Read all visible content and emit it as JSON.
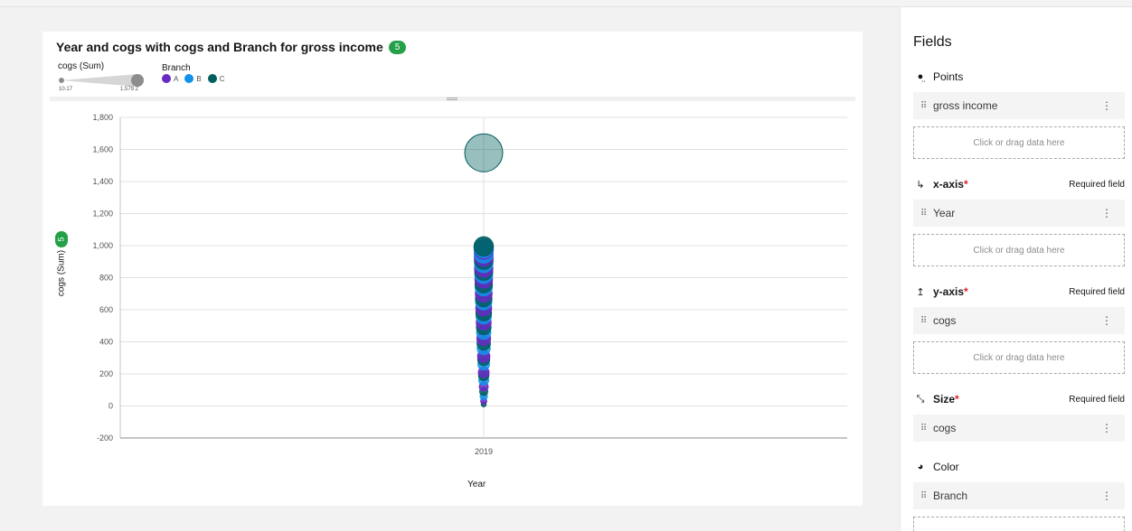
{
  "chart_card": {
    "title": "Year and cogs with cogs and Branch for gross income",
    "count_badge": "5",
    "size_legend": {
      "label": "cogs (Sum)",
      "min": "10.17",
      "max": "1,579.2"
    },
    "color_legend": {
      "label": "Branch",
      "items": [
        {
          "label": "A",
          "color": "#6929c4"
        },
        {
          "label": "B",
          "color": "#1192e8"
        },
        {
          "label": "C",
          "color": "#005d5d"
        }
      ]
    },
    "yaxis_badge": "5"
  },
  "chart_data": {
    "type": "scatter",
    "title": "Year and cogs with cogs and Branch for gross income",
    "xlabel": "Year",
    "ylabel": "cogs (Sum)",
    "categories": [
      "2019"
    ],
    "ylim": [
      -200,
      1800
    ],
    "yticks": [
      "-200",
      "0",
      "200",
      "400",
      "600",
      "800",
      "1,000",
      "1,200",
      "1,400",
      "1,600",
      "1,800"
    ],
    "grid": true,
    "size_field": "cogs (Sum)",
    "color_field": "Branch",
    "series": [
      {
        "name": "A",
        "color": "#6929c4",
        "points": [
          [
            2019,
            30
          ],
          [
            2019,
            120
          ],
          [
            2019,
            210
          ],
          [
            2019,
            310
          ],
          [
            2019,
            420
          ],
          [
            2019,
            520
          ],
          [
            2019,
            610
          ],
          [
            2019,
            700
          ],
          [
            2019,
            790
          ],
          [
            2019,
            860
          ],
          [
            2019,
            930
          ],
          [
            2019,
            975
          ]
        ]
      },
      {
        "name": "B",
        "color": "#1192e8",
        "points": [
          [
            2019,
            60
          ],
          [
            2019,
            160
          ],
          [
            2019,
            260
          ],
          [
            2019,
            360
          ],
          [
            2019,
            460
          ],
          [
            2019,
            560
          ],
          [
            2019,
            650
          ],
          [
            2019,
            740
          ],
          [
            2019,
            820
          ],
          [
            2019,
            890
          ],
          [
            2019,
            950
          ],
          [
            2019,
            985
          ]
        ]
      },
      {
        "name": "C",
        "color": "#005d5d",
        "points": [
          [
            2019,
            10
          ],
          [
            2019,
            90
          ],
          [
            2019,
            190
          ],
          [
            2019,
            290
          ],
          [
            2019,
            390
          ],
          [
            2019,
            490
          ],
          [
            2019,
            580
          ],
          [
            2019,
            670
          ],
          [
            2019,
            760
          ],
          [
            2019,
            840
          ],
          [
            2019,
            910
          ],
          [
            2019,
            995
          ],
          [
            2019,
            1579.2
          ]
        ]
      }
    ]
  },
  "fields_panel": {
    "title": "Fields",
    "sections": [
      {
        "id": "points",
        "icon": "points-icon",
        "label": "Points",
        "required": false,
        "value": "gross income",
        "drop_text": "Click or drag data here"
      },
      {
        "id": "xaxis",
        "icon": "x-axis-icon",
        "label": "x-axis",
        "required": true,
        "required_text": "Required field",
        "value": "Year",
        "drop_text": "Click or drag data here"
      },
      {
        "id": "yaxis",
        "icon": "y-axis-icon",
        "label": "y-axis",
        "required": true,
        "required_text": "Required field",
        "value": "cogs",
        "drop_text": "Click or drag data here"
      },
      {
        "id": "size",
        "icon": "size-icon",
        "label": "Size",
        "required": true,
        "required_text": "Required field",
        "value": "cogs"
      },
      {
        "id": "color",
        "icon": "palette-icon",
        "label": "Color",
        "required": false,
        "value": "Branch"
      }
    ],
    "drag_glyph": "⠿",
    "kebab_glyph": "⋮",
    "star": "*"
  }
}
